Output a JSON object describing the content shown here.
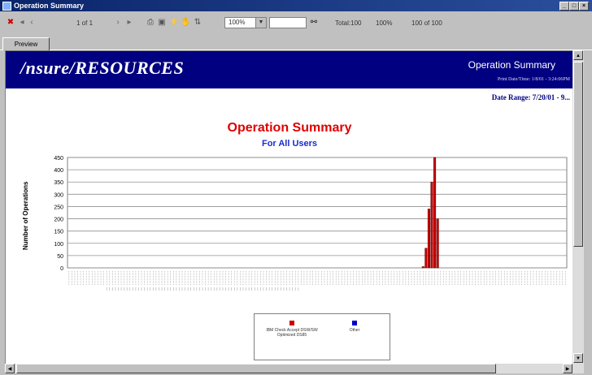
{
  "window": {
    "title": "Operation Summary"
  },
  "toolbar": {
    "page_indicator": "1 of 1",
    "zoom_value": "100%",
    "search_value": "",
    "total_label": "Total:100",
    "total_value": "100%",
    "records_label": "100 of 100"
  },
  "tabs": [
    {
      "label": "Preview"
    }
  ],
  "report": {
    "logo": "/nsure/RESOURCES",
    "header_title": "Operation Summary",
    "print_date": "Print Date/Time: 1/8/01 - 3:24:06PM",
    "date_range": "Date Range: 7/20/01 - 9..."
  },
  "chart_data": {
    "type": "bar",
    "title": "Operation Summary",
    "subtitle": "For All Users",
    "xlabel": "",
    "ylabel": "Number of Operations",
    "ylim": [
      0,
      450
    ],
    "yticks": [
      0,
      50,
      100,
      150,
      200,
      250,
      300,
      350,
      400,
      450
    ],
    "grid": true,
    "legend_position": "bottom",
    "series": [
      {
        "name": "IBM Check Accept DSW/SW Optimized DS85",
        "color": "#cc0000",
        "values": [
          0,
          0,
          0,
          0,
          0,
          0,
          0,
          0,
          0,
          0,
          0,
          0,
          0,
          0,
          0,
          0,
          0,
          0,
          0,
          0,
          0,
          0,
          0,
          0,
          0,
          0,
          0,
          0,
          0,
          0,
          0,
          0,
          0,
          0,
          0,
          0,
          0,
          0,
          0,
          0,
          0,
          0,
          0,
          0,
          0,
          0,
          0,
          0,
          0,
          0,
          0,
          0,
          0,
          0,
          0,
          0,
          0,
          0,
          0,
          0,
          0,
          0,
          0,
          0,
          0,
          0,
          0,
          0,
          0,
          0,
          0,
          0,
          0,
          0,
          0,
          0,
          0,
          0,
          0,
          0,
          0,
          0,
          0,
          0,
          0,
          0,
          0,
          0,
          0,
          0,
          0,
          0,
          0,
          0,
          0,
          0,
          0,
          0,
          0,
          0,
          0,
          0,
          0,
          0,
          0,
          0,
          0,
          0,
          0,
          0,
          0,
          0,
          0,
          0,
          0,
          0,
          0,
          0,
          0,
          0,
          0,
          0,
          5,
          80,
          240,
          350,
          450,
          200,
          0,
          0,
          0,
          0,
          0,
          0,
          0,
          0,
          0,
          0,
          0,
          0,
          0,
          0,
          0,
          0,
          0,
          0,
          0,
          0,
          0,
          0,
          0,
          0,
          0,
          0,
          0,
          0,
          0,
          0,
          0,
          0,
          0,
          0,
          0,
          0,
          0,
          0,
          0,
          0,
          0,
          0,
          0,
          0
        ]
      },
      {
        "name": "Other",
        "color": "#0000cc",
        "values": []
      }
    ]
  },
  "legend": {
    "items": [
      {
        "label": "IBM Check Accept DSW/SW Optimized DS85",
        "color": "#cc0000"
      },
      {
        "label": "Other",
        "color": "#0000cc"
      }
    ]
  }
}
